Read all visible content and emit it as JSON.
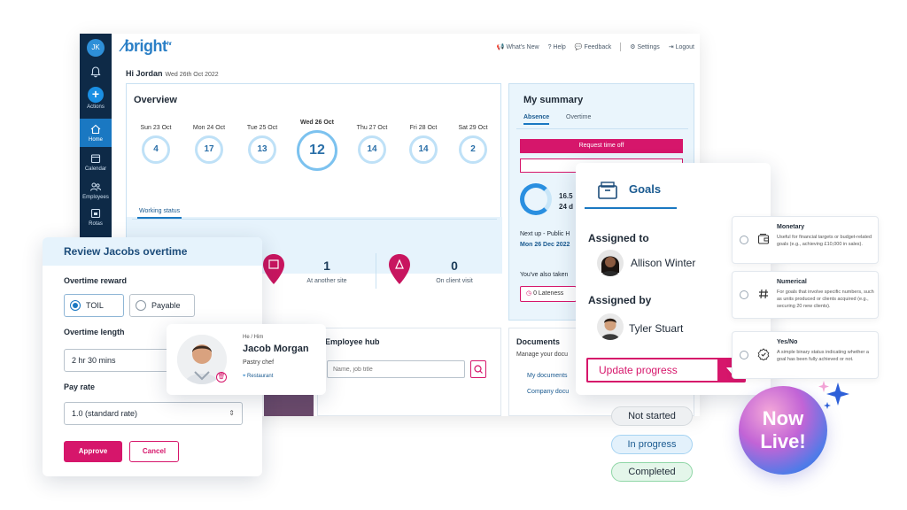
{
  "sidebar": {
    "avatar_initials": "JK",
    "items": [
      {
        "label": ""
      },
      {
        "label": "Actions"
      },
      {
        "label": "Home"
      },
      {
        "label": "Calendar"
      },
      {
        "label": "Employees"
      },
      {
        "label": "Rotas"
      }
    ]
  },
  "topbar": {
    "logo": "bright",
    "logo_sup": "hr",
    "links": [
      "What's New",
      "Help",
      "Feedback",
      "Settings",
      "Logout"
    ]
  },
  "greeting": {
    "text": "Hi Jordan",
    "date": "Wed 26th Oct 2022"
  },
  "overview": {
    "title": "Overview",
    "days": [
      {
        "label": "Sun 23 Oct",
        "value": "4"
      },
      {
        "label": "Mon 24 Oct",
        "value": "17"
      },
      {
        "label": "Tue 25 Oct",
        "value": "13"
      },
      {
        "label": "Wed 26 Oct",
        "value": "12"
      },
      {
        "label": "Thu 27 Oct",
        "value": "14"
      },
      {
        "label": "Fri 28 Oct",
        "value": "14"
      },
      {
        "label": "Sat 29 Oct",
        "value": "2"
      }
    ],
    "working_status_tab": "Working status",
    "stats": [
      {
        "value": "1",
        "label": "At another site"
      },
      {
        "value": "0",
        "label": "On client visit"
      }
    ]
  },
  "summary": {
    "title": "My summary",
    "tabs": [
      "Absence",
      "Overtime"
    ],
    "request_button": "Request time off",
    "value1": "16.5",
    "value2": "24 d",
    "next_up": "Next up - Public H",
    "next_up_date": "Mon 26 Dec 2022",
    "also_taken": "You've also taken",
    "lateness": "0 Lateness"
  },
  "hub": {
    "employee_title": "Employee hub",
    "search_placeholder": "Name, job title",
    "documents_title": "Documents",
    "documents_sub": "Manage your docu",
    "documents_links": [
      "My documents",
      "Company docu"
    ]
  },
  "overtime": {
    "title": "Review Jacobs overtime",
    "reward_label": "Overtime reward",
    "options": [
      "TOIL",
      "Payable"
    ],
    "length_label": "Overtime length",
    "length_value": "2 hr 30 mins",
    "pay_label": "Pay rate",
    "pay_value": "1.0 (standard rate)",
    "approve": "Approve",
    "cancel": "Cancel"
  },
  "profile": {
    "pronouns": "He / Him",
    "name": "Jacob Morgan",
    "role": "Pastry chef",
    "location": "Restaurant"
  },
  "goals": {
    "title": "Goals",
    "assigned_to_label": "Assigned to",
    "assigned_to": "Allison Winter",
    "assigned_by_label": "Assigned by",
    "assigned_by": "Tyler Stuart",
    "update_button": "Update progress"
  },
  "goal_types": [
    {
      "title": "Monetary",
      "desc": "Useful for financial targets or budget-related goals (e.g., achieving £10,000 in sales)."
    },
    {
      "title": "Numerical",
      "desc": "For goals that involve specific numbers, such as units produced or clients acquired (e.g., securing 20 new clients)."
    },
    {
      "title": "Yes/No",
      "desc": "A simple binary status indicating whether a goal has been fully achieved or not."
    }
  ],
  "statuses": [
    "Not started",
    "In progress",
    "Completed"
  ],
  "badge": {
    "line1": "Now",
    "line2": "Live!"
  },
  "colors": {
    "brand_pink": "#d6166b",
    "brand_blue": "#1a78c2",
    "navy": "#0e2a47"
  }
}
